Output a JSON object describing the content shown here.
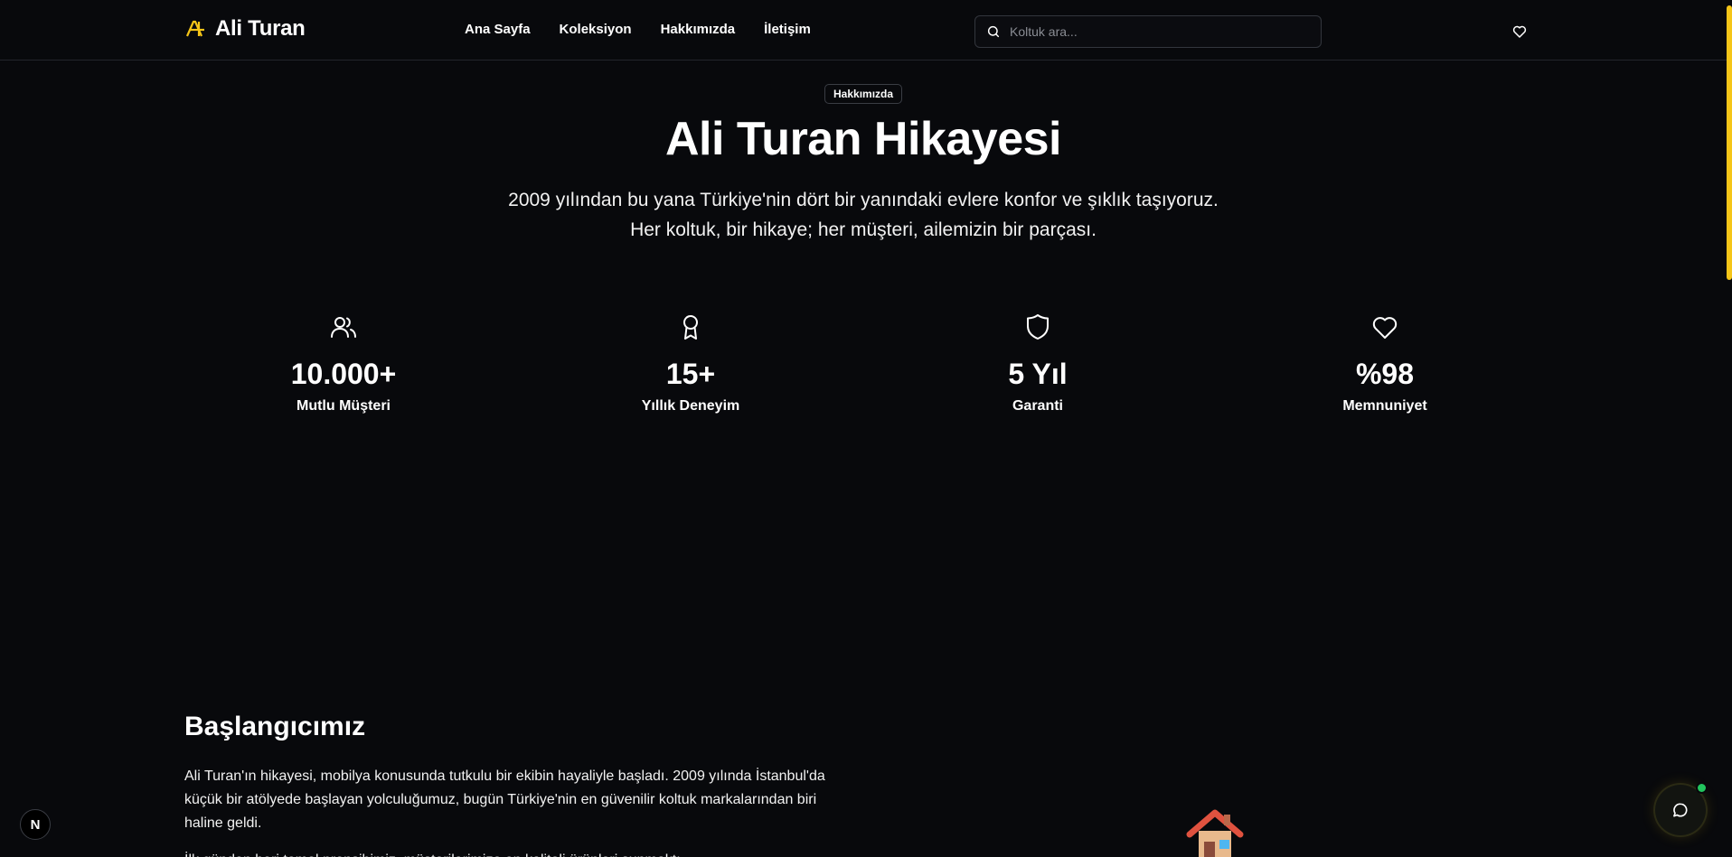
{
  "header": {
    "logo_text": "Ali Turan",
    "nav": [
      "Ana Sayfa",
      "Koleksiyon",
      "Hakkımızda",
      "İletişim"
    ],
    "search_placeholder": "Koltuk ara...",
    "accent_color": "#f5c518"
  },
  "hero": {
    "badge": "Hakkımızda",
    "title": "Ali Turan Hikayesi",
    "subtitle": "2009 yılından bu yana Türkiye'nin dört bir yanındaki evlere konfor ve şıklık taşıyoruz. Her koltuk, bir hikaye; her müşteri, ailemizin bir parçası."
  },
  "stats": [
    {
      "icon": "users-icon",
      "value": "10.000+",
      "label": "Mutlu Müşteri"
    },
    {
      "icon": "award-icon",
      "value": "15+",
      "label": "Yıllık Deneyim"
    },
    {
      "icon": "shield-icon",
      "value": "5 Yıl",
      "label": "Garanti"
    },
    {
      "icon": "heart-icon",
      "value": "%98",
      "label": "Memnuniyet"
    }
  ],
  "story": {
    "title": "Başlangıcımız",
    "paragraph1": "Ali Turan'ın hikayesi, mobilya konusunda tutkulu bir ekibin hayaliyle başladı. 2009 yılında İstanbul'da küçük bir atölyede başlayan yolculuğumuz, bugün Türkiye'nin en güvenilir koltuk markalarından biri haline geldi.",
    "paragraph2": "İlk günden beri temel prensibimiz, müşterilerimize en kaliteli ürünleri sunmaktı."
  },
  "floating": {
    "next_badge": "N",
    "chat_status_color": "#22c55e"
  }
}
